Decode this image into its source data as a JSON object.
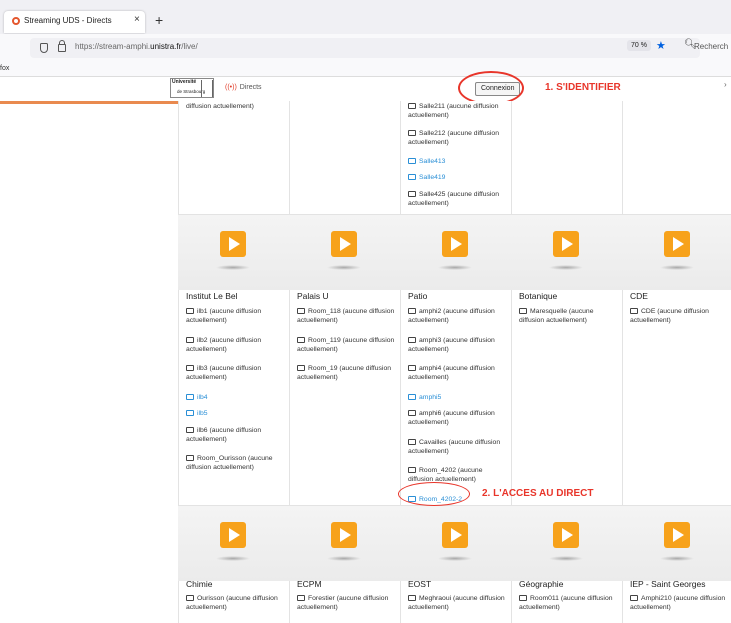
{
  "browser": {
    "tab_title": "Streaming UDS - Directs",
    "tab_close": "×",
    "new_tab": "+",
    "url_prefix": "https://stream-amphi.",
    "url_domain": "unistra.fr",
    "url_path": "/live/",
    "zoom": "70 %",
    "search_placeholder": "Recherch",
    "bookmark": "fox"
  },
  "header": {
    "logo_top": "Université",
    "logo_bottom": "de Strasbourg",
    "directs": "Directs",
    "login_button": "Connexion",
    "annotation_1": "1. S'IDENTIFIER"
  },
  "top_row": {
    "col1": [
      "diffusion actuellement)"
    ],
    "col3": [
      {
        "label": "Salle211 (aucune diffusion actuellement)",
        "live": false
      },
      {
        "label": "Salle212 (aucune diffusion actuellement)",
        "live": false
      },
      {
        "label": "Salle413",
        "live": true
      },
      {
        "label": "Salle419",
        "live": true
      },
      {
        "label": "Salle425 (aucune diffusion actuellement)",
        "live": false
      }
    ]
  },
  "row2": [
    {
      "title": "Institut Le Bel",
      "rooms": [
        {
          "label": "ilb1 (aucune diffusion actuellement)",
          "live": false
        },
        {
          "label": "ilb2 (aucune diffusion actuellement)",
          "live": false
        },
        {
          "label": "ilb3 (aucune diffusion actuellement)",
          "live": false
        },
        {
          "label": "ilb4",
          "live": true
        },
        {
          "label": "ilb5",
          "live": true
        },
        {
          "label": "ilb6 (aucune diffusion actuellement)",
          "live": false
        },
        {
          "label": "Room_Ourisson (aucune diffusion actuellement)",
          "live": false
        }
      ]
    },
    {
      "title": "Palais U",
      "rooms": [
        {
          "label": "Room_118 (aucune diffusion actuellement)",
          "live": false
        },
        {
          "label": "Room_119 (aucune diffusion actuellement)",
          "live": false
        },
        {
          "label": "Room_19 (aucune diffusion actuellement)",
          "live": false
        }
      ]
    },
    {
      "title": "Patio",
      "rooms": [
        {
          "label": "amphi2 (aucune diffusion actuellement)",
          "live": false
        },
        {
          "label": "amphi3 (aucune diffusion actuellement)",
          "live": false
        },
        {
          "label": "amphi4 (aucune diffusion actuellement)",
          "live": false
        },
        {
          "label": "amphi5",
          "live": true
        },
        {
          "label": "amphi6 (aucune diffusion actuellement)",
          "live": false
        },
        {
          "label": "Cavailles (aucune diffusion actuellement)",
          "live": false
        },
        {
          "label": "Room_4202 (aucune diffusion actuellement)",
          "live": false
        },
        {
          "label": "Room_4202-2",
          "live": true
        }
      ]
    },
    {
      "title": "Botanique",
      "rooms": [
        {
          "label": "Maresquelle (aucune diffusion actuellement)",
          "live": false
        }
      ]
    },
    {
      "title": "CDE",
      "rooms": [
        {
          "label": "CDE (aucune diffusion actuellement)",
          "live": false
        }
      ]
    }
  ],
  "annotation_2": "2. L'ACCES AU DIRECT",
  "row3": [
    {
      "title": "Chimie",
      "rooms": [
        {
          "label": "Ourisson (aucune diffusion actuellement)",
          "live": false
        }
      ]
    },
    {
      "title": "ECPM",
      "rooms": [
        {
          "label": "Forestier (aucune diffusion actuellement)",
          "live": false
        }
      ]
    },
    {
      "title": "EOST",
      "rooms": [
        {
          "label": "Meghraoui (aucune diffusion actuellement)",
          "live": false
        }
      ]
    },
    {
      "title": "Géographie",
      "rooms": [
        {
          "label": "Room011 (aucune diffusion actuellement)",
          "live": false
        }
      ]
    },
    {
      "title": "IEP - Saint Georges",
      "rooms": [
        {
          "label": "Amphi210 (aucune diffusion actuellement)",
          "live": false
        }
      ]
    }
  ]
}
